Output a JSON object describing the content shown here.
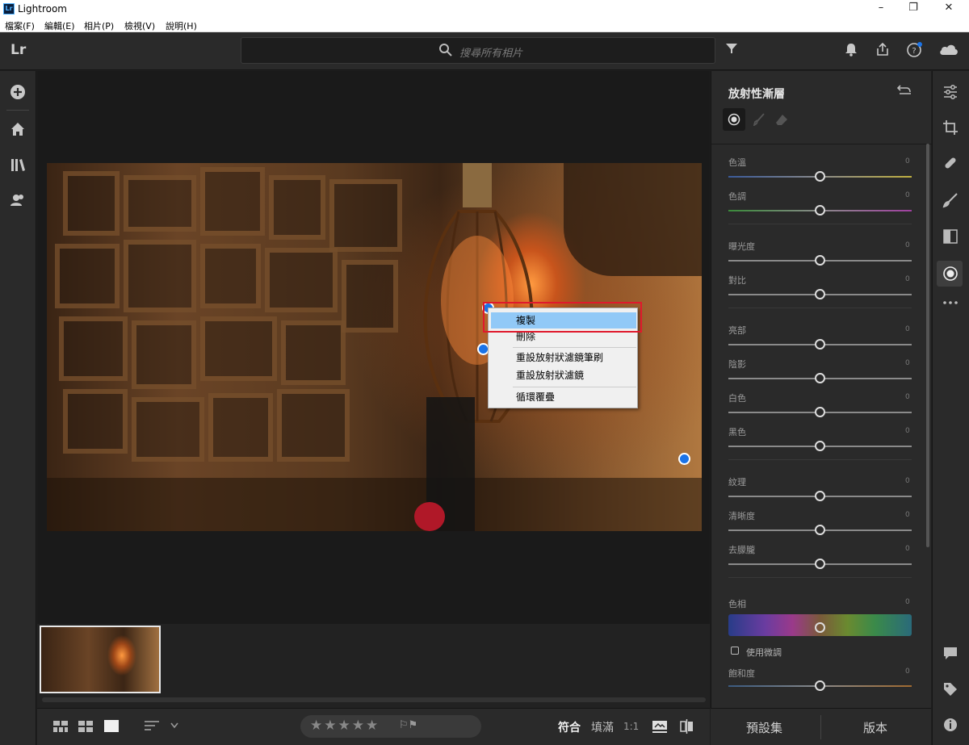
{
  "window": {
    "title": "Lightroom",
    "logo_text": "Lr",
    "minimize": "–",
    "maximize": "❐",
    "close": "✕"
  },
  "menu": [
    "檔案(F)",
    "編輯(E)",
    "相片(P)",
    "檢視(V)",
    "說明(H)"
  ],
  "topbar": {
    "brand": "Lr",
    "search_placeholder": "搜尋所有相片"
  },
  "left_nav": [
    "add-icon",
    "home-icon",
    "library-icon",
    "people-icon"
  ],
  "context_menu": {
    "items": [
      "複製",
      "刪除",
      "重設放射狀濾鏡筆刷",
      "重設放射狀濾鏡",
      "循環覆疊"
    ],
    "highlighted": "複製"
  },
  "bottombar": {
    "fit": "符合",
    "fill": "填滿",
    "ratio": "1:1",
    "stars": "★★★★★",
    "flags": "⚐⚑"
  },
  "panel": {
    "title": "放射性漸層",
    "groups": [
      [
        {
          "label": "色溫",
          "value": "0"
        },
        {
          "label": "色調",
          "value": "0"
        }
      ],
      [
        {
          "label": "曝光度",
          "value": "0"
        },
        {
          "label": "對比",
          "value": "0"
        }
      ],
      [
        {
          "label": "亮部",
          "value": "0"
        },
        {
          "label": "陰影",
          "value": "0"
        },
        {
          "label": "白色",
          "value": "0"
        },
        {
          "label": "黑色",
          "value": "0"
        }
      ],
      [
        {
          "label": "紋理",
          "value": "0"
        },
        {
          "label": "清晰度",
          "value": "0"
        },
        {
          "label": "去朦朧",
          "value": "0"
        }
      ]
    ],
    "hue": {
      "label": "色相",
      "value": "0"
    },
    "fine_tune": "使用微調",
    "saturation": {
      "label": "飽和度",
      "value": "0"
    },
    "presets": "預設集",
    "versions": "版本"
  },
  "colors": {
    "accent": "#1a73e8",
    "panel_bg": "#2a2a2a",
    "highlight": "#91c9f7",
    "annotation": "#e0192c"
  }
}
